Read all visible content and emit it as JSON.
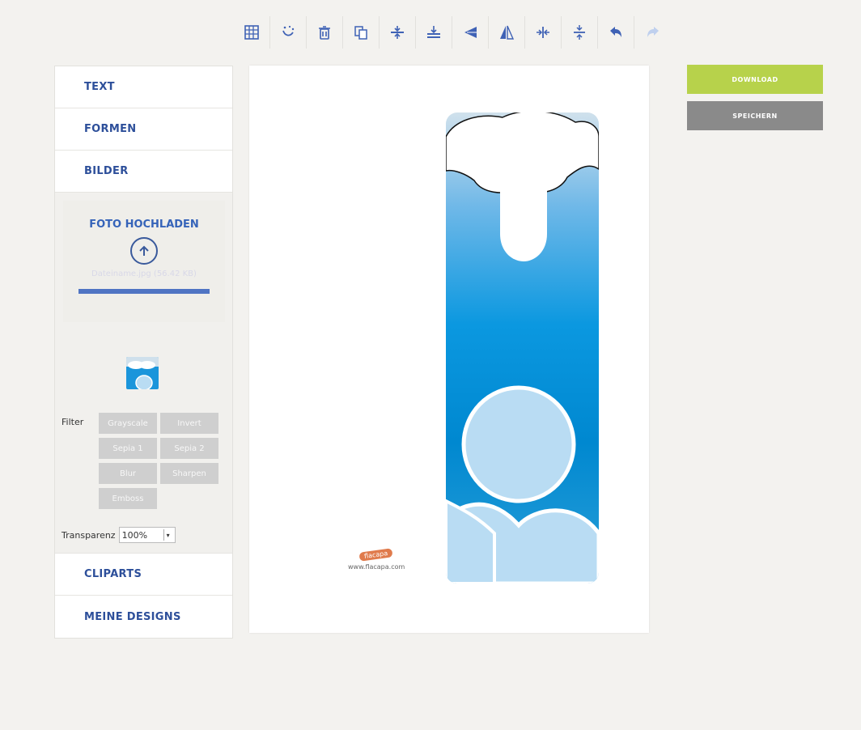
{
  "toolbar": {
    "icons": [
      "grid-icon",
      "magic-wand-icon",
      "trash-icon",
      "copy-icon",
      "align-vertical-center-icon",
      "align-middle-icon",
      "flip-horizontal-icon",
      "flip-vertical-icon",
      "align-horizontal-icon",
      "distribute-vertical-icon",
      "undo-icon",
      "redo-icon"
    ]
  },
  "sidebar": {
    "text": "TEXT",
    "formen": "FORMEN",
    "bilder": "BILDER",
    "upload_title": "FOTO HOCHLADEN",
    "upload_hint": "Dateiname.jpg (56.42 KB)",
    "upload_progress": 1.0,
    "filter_label": "Filter",
    "filters": [
      "Grayscale",
      "Invert",
      "Sepia 1",
      "Sepia 2",
      "Blur",
      "Sharpen",
      "Emboss"
    ],
    "transparency_label": "Transparenz",
    "transparency_value": "100%",
    "cliparts": "CLIPARTS",
    "meine_designs": "MEINE DESIGNS"
  },
  "canvas": {
    "logo_text": "flacapa",
    "logo_url": "www.flacapa.com"
  },
  "buttons": {
    "download": "DOWNLOAD",
    "save": "SPEICHERN"
  },
  "colors": {
    "accent_blue": "#2d4f9a",
    "download_green": "#b7d24b",
    "save_gray": "#8a8a8a"
  }
}
